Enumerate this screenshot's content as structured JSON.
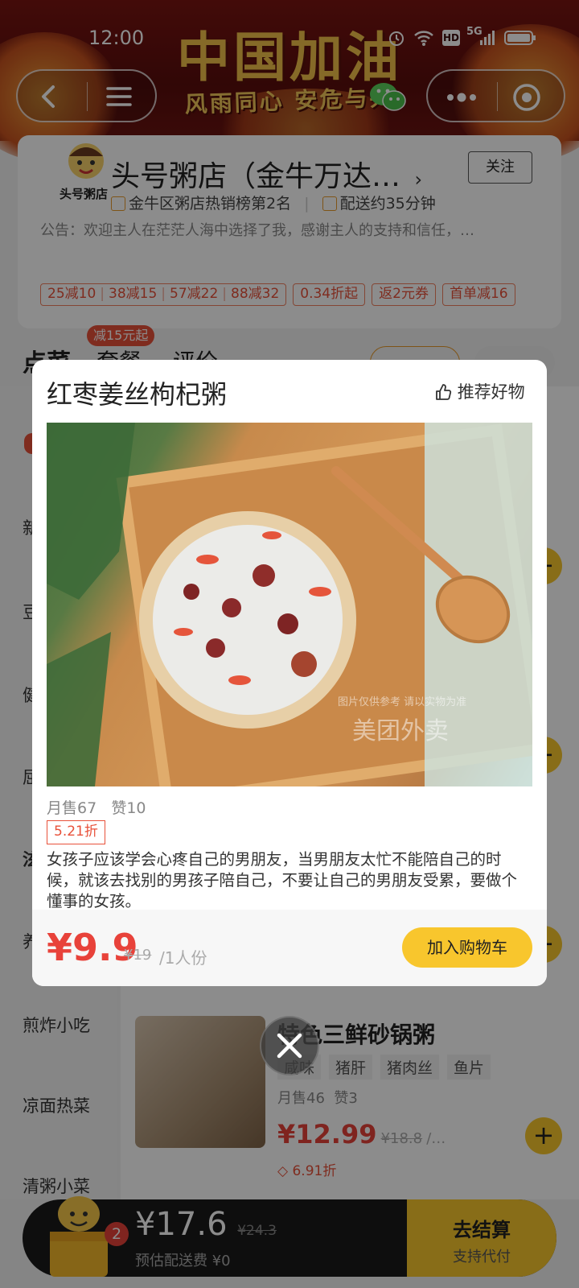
{
  "status_bar": {
    "time": "12:00",
    "network": "5G"
  },
  "banner": {
    "title": "中国加油",
    "subtitle": "风雨同心 安危与共"
  },
  "store": {
    "logo_text": "头号粥店",
    "name": "头号粥店（金牛万达…",
    "follow_label": "关注",
    "rank_text": "金牛区粥店热销榜第2名",
    "delivery_text": "配送约35分钟",
    "notice": "公告：欢迎主人在茫茫人海中选择了我，感谢主人的支持和信任，…",
    "coupons": [
      "25减10",
      "38减15",
      "57减22",
      "88减32",
      "0.34折起",
      "返2元券",
      "首单减16"
    ]
  },
  "tabs": {
    "order": "点菜",
    "package": "套餐",
    "review": "评价",
    "package_badge": "减15元起"
  },
  "categories": [
    "新",
    "豆",
    "健",
    "屈",
    "泫",
    "养",
    "煎炸小吃",
    "凉面热菜",
    "清粥小菜"
  ],
  "modal": {
    "title": "红枣姜丝枸杞粥",
    "recommend_label": "推荐好物",
    "watermark": "图片仅供参考 请以实物为准",
    "brand_watermark": "美团外卖",
    "monthly_sales": "月售67",
    "likes": "赞10",
    "discount": "5.21折",
    "description": "女孩子应该学会心疼自己的男朋友，当男朋友太忙不能陪自己的时候，就该去找别的男孩子陪自己，不要让自己的男朋友受累，要做个懂事的女孩。",
    "price": "¥9.9",
    "original_price": "¥19",
    "unit": "/1人份",
    "add_to_cart": "加入购物车"
  },
  "bg_item": {
    "name": "特色三鲜砂锅粥",
    "tags": [
      "咸味",
      "猪肝",
      "猪肉丝",
      "鱼片"
    ],
    "monthly_sales": "月售46",
    "likes": "赞3",
    "price": "¥12.99",
    "original_price": "¥18.8",
    "unit": "/…",
    "discount": "6.91折"
  },
  "cart": {
    "count": "2",
    "total": "¥17.6",
    "original_total": "¥24.3",
    "delivery_fee": "预估配送费 ¥0",
    "checkout": "去结算",
    "checkout_sub": "支持代付"
  },
  "colors": {
    "accent_yellow": "#f8c62d",
    "price_red": "#e8423a",
    "banner_red": "#6b1410"
  }
}
